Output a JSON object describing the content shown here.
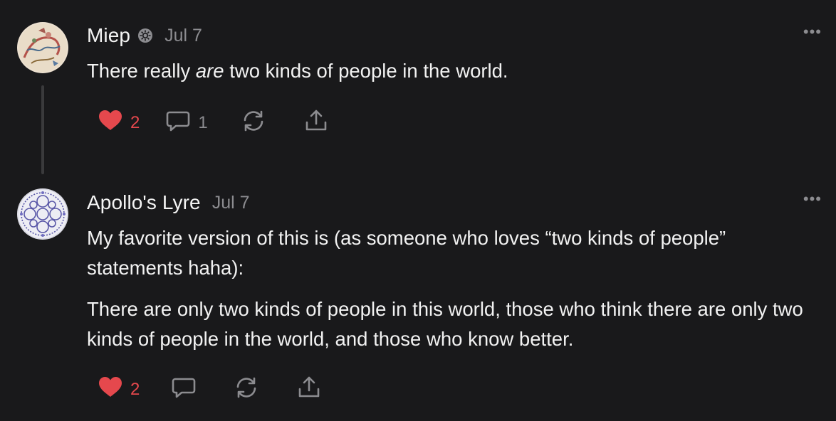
{
  "colors": {
    "background": "#19191b",
    "text": "#f2f2f2",
    "muted": "#8c8c90",
    "like": "#e5484d",
    "thread_line": "#3a3a3c"
  },
  "icons": {
    "like": "heart-icon",
    "reply": "speech-bubble-icon",
    "restack": "refresh-arrows-icon",
    "share": "share-upload-icon",
    "more": "ellipsis-icon",
    "badge": "gear-badge-icon"
  },
  "posts": [
    {
      "author": "Miep",
      "date": "Jul 7",
      "has_badge": true,
      "text_before_em": "There really ",
      "text_em": "are",
      "text_after_em": " two kinds of people in the world.",
      "more": "•••",
      "likes": "2",
      "liked": true,
      "replies": "1"
    },
    {
      "author": "Apollo's Lyre",
      "date": "Jul 7",
      "has_badge": false,
      "paragraphs": [
        "My favorite version of this is (as someone who loves “two kinds of people” statements haha):",
        "There are only two kinds of people in this world, those who think there are only two kinds of people in the world, and those who know better."
      ],
      "more": "•••",
      "likes": "2",
      "liked": true,
      "replies": ""
    }
  ]
}
